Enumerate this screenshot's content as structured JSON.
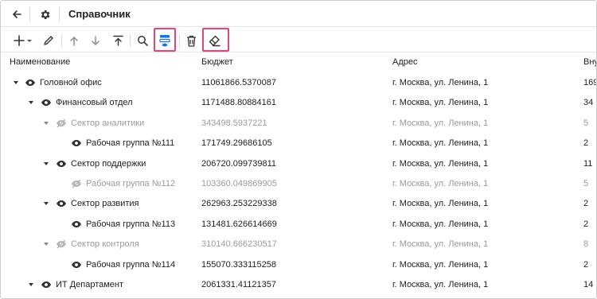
{
  "header": {
    "title": "Справочник"
  },
  "toolbar": {
    "icons": [
      "add-icon",
      "chevron-down-icon",
      "edit-icon",
      "arrow-up-icon",
      "arrow-down-icon",
      "move-to-top-icon",
      "search-icon",
      "filter-row-icon",
      "delete-icon",
      "eraser-icon"
    ],
    "highlight_color": "#e0457b",
    "active_color": "#1a73e8"
  },
  "table": {
    "columns": [
      "Наименование",
      "Бюджет",
      "Адрес",
      "Вну"
    ],
    "rows": [
      {
        "name": "Головной офис",
        "budget": "11061866.5370087",
        "address": "г. Москва, ул. Ленина, 1",
        "extra": "169",
        "level": 0,
        "expandable": true,
        "hidden": false
      },
      {
        "name": "Финансовый отдел",
        "budget": "1171488.80884161",
        "address": "г. Москва, ул. Ленина, 1",
        "extra": "34",
        "level": 1,
        "expandable": true,
        "hidden": false
      },
      {
        "name": "Сектор аналитики",
        "budget": "343498.5937221",
        "address": "г. Москва, ул. Ленина, 1",
        "extra": "5",
        "level": 2,
        "expandable": true,
        "hidden": true
      },
      {
        "name": "Рабочая группа №111",
        "budget": "171749.29686105",
        "address": "г. Москва, ул. Ленина, 1",
        "extra": "2",
        "level": 3,
        "expandable": false,
        "hidden": false
      },
      {
        "name": "Сектор поддержки",
        "budget": "206720.099739811",
        "address": "г. Москва, ул. Ленина, 1",
        "extra": "11",
        "level": 2,
        "expandable": true,
        "hidden": false
      },
      {
        "name": "Рабочая группа №112",
        "budget": "103360.049869905",
        "address": "г. Москва, ул. Ленина, 1",
        "extra": "5",
        "level": 3,
        "expandable": false,
        "hidden": true
      },
      {
        "name": "Сектор развития",
        "budget": "262963.253229338",
        "address": "г. Москва, ул. Ленина, 1",
        "extra": "2",
        "level": 2,
        "expandable": true,
        "hidden": false
      },
      {
        "name": "Рабочая группа №113",
        "budget": "131481.626614669",
        "address": "г. Москва, ул. Ленина, 1",
        "extra": "2",
        "level": 3,
        "expandable": false,
        "hidden": false
      },
      {
        "name": "Сектор контроля",
        "budget": "310140.666230517",
        "address": "г. Москва, ул. Ленина, 1",
        "extra": "8",
        "level": 2,
        "expandable": true,
        "hidden": true
      },
      {
        "name": "Рабочая группа №114",
        "budget": "155070.333115258",
        "address": "г. Москва, ул. Ленина, 1",
        "extra": "2",
        "level": 3,
        "expandable": false,
        "hidden": false
      },
      {
        "name": "ИТ Департамент",
        "budget": "2061331.41121357",
        "address": "г. Москва, ул. Ленина, 1",
        "extra": "14",
        "level": 1,
        "expandable": true,
        "hidden": false
      }
    ]
  }
}
